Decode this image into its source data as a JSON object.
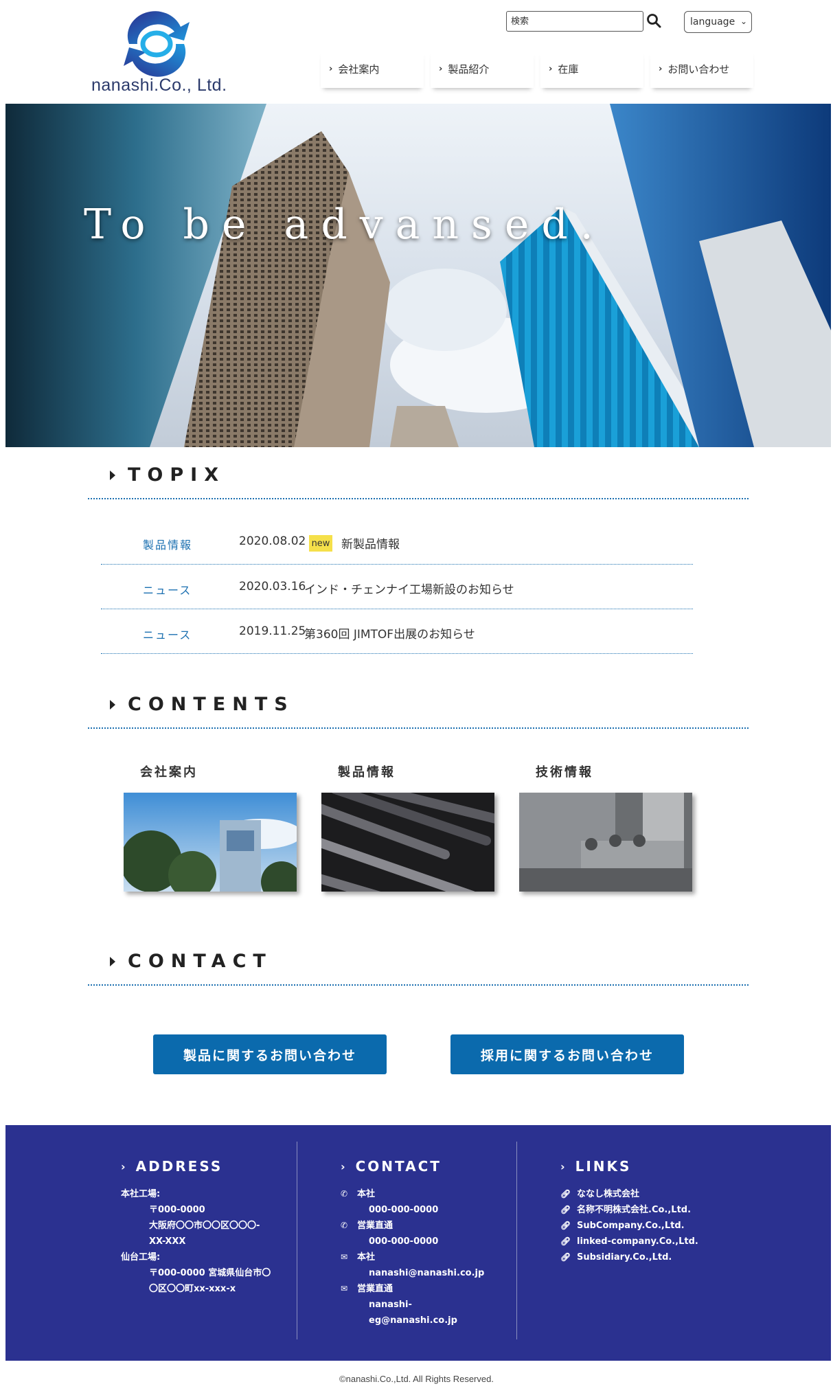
{
  "header": {
    "logo_text": "nanashi.Co., Ltd.",
    "search_placeholder": "検索",
    "language_label": "language",
    "nav": [
      {
        "label": "会社案内"
      },
      {
        "label": "製品紹介"
      },
      {
        "label": "在庫"
      },
      {
        "label": "お問い合わせ"
      }
    ]
  },
  "hero": {
    "title": "To be advansed."
  },
  "topix": {
    "heading": "TOPIX",
    "items": [
      {
        "category": "製品情報",
        "date": "2020.08.02",
        "badge": "new",
        "text": "新製品情報"
      },
      {
        "category": "ニュース",
        "date": "2020.03.16",
        "text": "インド・チェンナイ工場新設のお知らせ"
      },
      {
        "category": "ニュース",
        "date": "2019.11.25",
        "text": "第360回 JIMTOF出展のお知らせ"
      }
    ]
  },
  "contents": {
    "heading": "CONTENTS",
    "cards": [
      {
        "label": "会社案内"
      },
      {
        "label": "製品情報"
      },
      {
        "label": "技術情報"
      }
    ]
  },
  "contact": {
    "heading": "CONTACT",
    "buttons": [
      {
        "label": "製品に関するお問い合わせ"
      },
      {
        "label": "採用に関するお問い合わせ"
      }
    ]
  },
  "footer": {
    "address": {
      "title": "ADDRESS",
      "main_label": "本社工場:",
      "main_lines": [
        "〒000-0000",
        "大阪府〇〇市〇〇区〇〇〇-",
        "XX-XXX"
      ],
      "sendai_label": "仙台工場:",
      "sendai_lines": [
        "〒000-0000 宮城県仙台市〇",
        "〇区〇〇町xx-xxx-x"
      ]
    },
    "contact": {
      "title": "CONTACT",
      "items": [
        {
          "icon": "phone-icon",
          "label": "本社",
          "value": "000-000-0000"
        },
        {
          "icon": "phone-icon",
          "label": "営業直通",
          "value": "000-000-0000"
        },
        {
          "icon": "mail-icon",
          "label": "本社",
          "value": "nanashi@nanashi.co.jp"
        },
        {
          "icon": "mail-icon",
          "label": "営業直通",
          "value_lines": [
            "nanashi-",
            "eg@nanashi.co.jp"
          ]
        }
      ]
    },
    "links": {
      "title": "LINKS",
      "items": [
        {
          "label": "ななし株式会社"
        },
        {
          "label": "名称不明株式会社.Co.,Ltd."
        },
        {
          "label": "SubCompany.Co.,Ltd."
        },
        {
          "label": "linked-company.Co.,Ltd."
        },
        {
          "label": "Subsidiary.Co.,Ltd."
        }
      ]
    },
    "copyright": "©nanashi.Co.,Ltd. All Rights Reserved."
  },
  "colors": {
    "accent": "#0b6aad",
    "footer_bg": "#2b3190",
    "badge": "#f5e04a"
  }
}
